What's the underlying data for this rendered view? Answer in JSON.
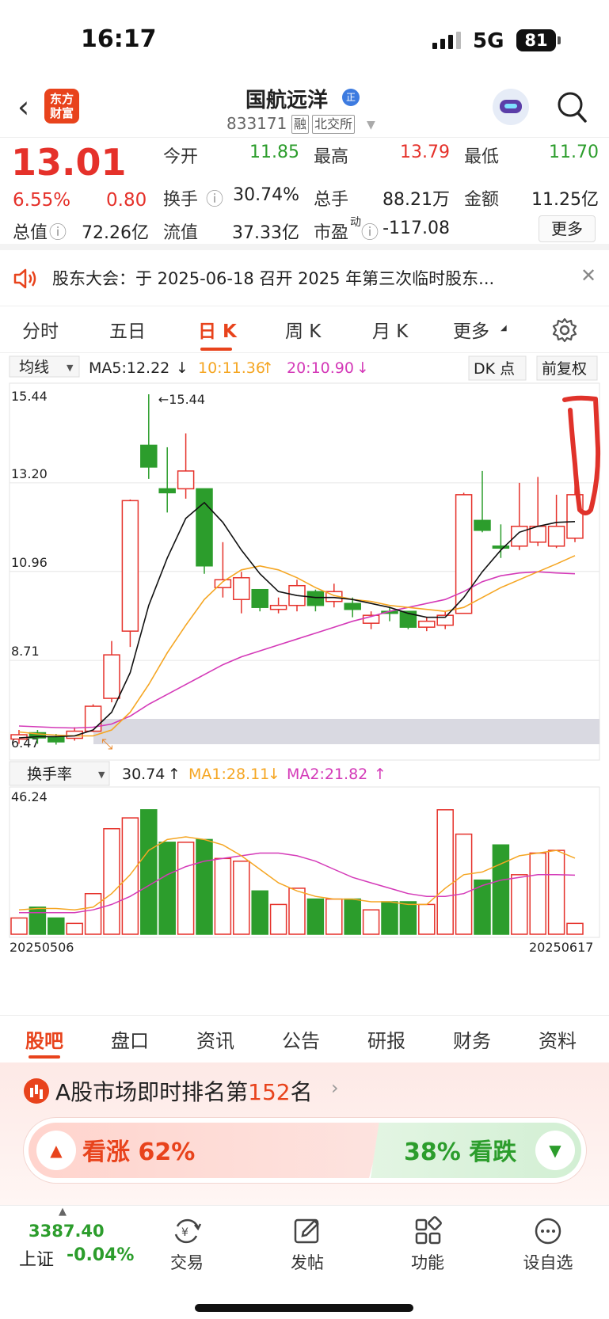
{
  "status": {
    "time": "16:17",
    "network": "5G",
    "battery": "81"
  },
  "nav": {
    "logo_text": "东方财富",
    "title": "国航远洋",
    "title_badge": "正",
    "code": "833171",
    "tags": [
      "融",
      "北交所"
    ]
  },
  "quote": {
    "price": "13.01",
    "change_pct": "6.55%",
    "change": "0.80",
    "fields": [
      {
        "label": "今开",
        "value": "11.85",
        "color": "green"
      },
      {
        "label": "最高",
        "value": "13.79",
        "color": "red"
      },
      {
        "label": "最低",
        "value": "11.70",
        "color": "green"
      },
      {
        "label": "换手",
        "value": "30.74%",
        "color": "black"
      },
      {
        "label": "总手",
        "value": "88.21万",
        "color": "black"
      },
      {
        "label": "金额",
        "value": "11.25亿",
        "color": "black"
      },
      {
        "label": "总值",
        "value": "72.26亿",
        "color": "black"
      },
      {
        "label": "流值",
        "value": "37.33亿",
        "color": "black"
      },
      {
        "label": "市盈",
        "value": "-117.08",
        "color": "black"
      }
    ],
    "pe_sup": "动",
    "more_label": "更多"
  },
  "notice": {
    "text": "股东大会：于 2025-06-18 召开 2025 年第三次临时股东..."
  },
  "chart_tabs": [
    "分时",
    "五日",
    "日 K",
    "周 K",
    "月 K",
    "更多"
  ],
  "chart_controls": {
    "indicator": "均线",
    "ma5": "MA5:12.22",
    "ma10": "10:11.36",
    "ma20": "20:10.90",
    "dk": "DK 点",
    "adjust": "前复权"
  },
  "chart_data": {
    "type": "candlestick",
    "y_ticks": [
      "15.44",
      "13.20",
      "10.96",
      "8.71",
      "6.47"
    ],
    "ylim": [
      6.47,
      15.44
    ],
    "max_label": "15.44",
    "min_label": "6.47",
    "candles": [
      {
        "o": 6.72,
        "c": 6.83,
        "h": 6.95,
        "l": 6.6,
        "up": true
      },
      {
        "o": 6.88,
        "c": 6.75,
        "h": 6.95,
        "l": 6.6,
        "up": false
      },
      {
        "o": 6.78,
        "c": 6.65,
        "h": 6.85,
        "l": 6.58,
        "up": false
      },
      {
        "o": 6.74,
        "c": 6.92,
        "h": 7.02,
        "l": 6.68,
        "up": true
      },
      {
        "o": 6.92,
        "c": 7.55,
        "h": 7.6,
        "l": 6.9,
        "up": true
      },
      {
        "o": 7.75,
        "c": 8.85,
        "h": 9.2,
        "l": 7.65,
        "up": true
      },
      {
        "o": 9.45,
        "c": 12.75,
        "h": 12.78,
        "l": 9.05,
        "up": true
      },
      {
        "o": 14.15,
        "c": 13.6,
        "h": 15.44,
        "l": 13.3,
        "up": false
      },
      {
        "o": 13.05,
        "c": 12.95,
        "h": 14.1,
        "l": 12.45,
        "up": false
      },
      {
        "o": 13.05,
        "c": 13.5,
        "h": 14.45,
        "l": 12.8,
        "up": true
      },
      {
        "o": 13.05,
        "c": 11.1,
        "h": 13.05,
        "l": 10.9,
        "up": false
      },
      {
        "o": 10.55,
        "c": 10.75,
        "h": 11.7,
        "l": 10.3,
        "up": true
      },
      {
        "o": 10.25,
        "c": 10.8,
        "h": 10.95,
        "l": 9.9,
        "up": true
      },
      {
        "o": 10.5,
        "c": 10.05,
        "h": 10.5,
        "l": 9.95,
        "up": false
      },
      {
        "o": 10.0,
        "c": 10.1,
        "h": 10.3,
        "l": 9.9,
        "up": true
      },
      {
        "o": 10.1,
        "c": 10.6,
        "h": 10.75,
        "l": 9.95,
        "up": true
      },
      {
        "o": 10.45,
        "c": 10.1,
        "h": 10.5,
        "l": 9.95,
        "up": false
      },
      {
        "o": 10.2,
        "c": 10.45,
        "h": 10.65,
        "l": 10.05,
        "up": true
      },
      {
        "o": 10.15,
        "c": 10.0,
        "h": 10.3,
        "l": 9.8,
        "up": false
      },
      {
        "o": 9.65,
        "c": 9.85,
        "h": 9.95,
        "l": 9.5,
        "up": true
      },
      {
        "o": 9.95,
        "c": 9.9,
        "h": 10.05,
        "l": 9.7,
        "up": false
      },
      {
        "o": 9.95,
        "c": 9.55,
        "h": 9.95,
        "l": 9.5,
        "up": false
      },
      {
        "o": 9.55,
        "c": 9.7,
        "h": 9.8,
        "l": 9.45,
        "up": true
      },
      {
        "o": 9.6,
        "c": 9.85,
        "h": 9.95,
        "l": 9.5,
        "up": true
      },
      {
        "o": 9.9,
        "c": 12.9,
        "h": 12.95,
        "l": 9.9,
        "up": true
      },
      {
        "o": 12.25,
        "c": 12.0,
        "h": 13.5,
        "l": 11.95,
        "up": false
      },
      {
        "o": 11.6,
        "c": 11.55,
        "h": 12.15,
        "l": 11.3,
        "up": false
      },
      {
        "o": 11.6,
        "c": 12.1,
        "h": 13.2,
        "l": 11.5,
        "up": true
      },
      {
        "o": 11.7,
        "c": 12.1,
        "h": 13.35,
        "l": 11.6,
        "up": true
      },
      {
        "o": 11.6,
        "c": 12.1,
        "h": 12.9,
        "l": 11.55,
        "up": true
      },
      {
        "o": 11.8,
        "c": 12.9,
        "h": 13.79,
        "l": 11.7,
        "up": true
      }
    ],
    "ma5": [
      6.75,
      6.78,
      6.78,
      6.8,
      6.95,
      7.4,
      8.4,
      10.1,
      11.3,
      12.3,
      12.7,
      12.2,
      11.5,
      10.9,
      10.45,
      10.35,
      10.3,
      10.3,
      10.25,
      10.15,
      10.05,
      9.9,
      9.8,
      9.8,
      10.3,
      10.95,
      11.5,
      11.95,
      12.1,
      12.2,
      12.22
    ],
    "ma10": [
      6.9,
      6.85,
      6.82,
      6.8,
      6.8,
      6.95,
      7.4,
      8.1,
      8.9,
      9.6,
      10.25,
      10.7,
      11.0,
      11.1,
      11.0,
      10.8,
      10.55,
      10.35,
      10.25,
      10.2,
      10.1,
      10.05,
      10.0,
      9.95,
      10.05,
      10.3,
      10.55,
      10.75,
      10.95,
      11.15,
      11.36
    ],
    "ma20": [
      7.05,
      7.03,
      7.01,
      7.0,
      7.02,
      7.1,
      7.3,
      7.6,
      7.85,
      8.1,
      8.35,
      8.6,
      8.8,
      8.95,
      9.1,
      9.25,
      9.4,
      9.55,
      9.7,
      9.82,
      9.95,
      10.05,
      10.15,
      10.25,
      10.45,
      10.7,
      10.85,
      10.92,
      10.95,
      10.92,
      10.9
    ]
  },
  "volume_controls": {
    "indicator": "换手率",
    "value": "30.74",
    "ma1": "MA1:28.11",
    "ma2": "MA2:21.82"
  },
  "volume_data": {
    "max_label": "46.24",
    "values": [
      6,
      10,
      6,
      4,
      15,
      39,
      43,
      46,
      34,
      34,
      35,
      28,
      27,
      16,
      11,
      17,
      13,
      13,
      13,
      9,
      12,
      12,
      11,
      46,
      37,
      20,
      33,
      22,
      30,
      31,
      4
    ],
    "ma1": [
      9,
      9.5,
      9.5,
      9,
      10,
      15,
      22,
      31,
      35,
      36,
      35,
      33,
      29,
      24,
      19,
      16,
      14,
      13,
      13,
      12,
      12,
      11,
      11,
      17,
      22,
      23,
      26,
      29,
      30,
      31,
      28.11
    ],
    "ma2": [
      8,
      8,
      8,
      8,
      9,
      11,
      14,
      18,
      22,
      25,
      27,
      28,
      29,
      30,
      30,
      29,
      27,
      24,
      21,
      19,
      17,
      15,
      14,
      14,
      15,
      18,
      20,
      21,
      22,
      22,
      21.82
    ],
    "date_start": "20250506",
    "date_end": "20250617"
  },
  "bottom_tabs": [
    "股吧",
    "盘口",
    "资讯",
    "公告",
    "研报",
    "财务",
    "资料"
  ],
  "rank": {
    "prefix": "A股市场即时排名第",
    "number": "152",
    "suffix": "名"
  },
  "vote": {
    "up": "看涨 62%",
    "down": "38% 看跌"
  },
  "index": {
    "value": "3387.40",
    "name": "上证",
    "change": "-0.04%"
  },
  "bottom_nav": [
    "交易",
    "发帖",
    "功能",
    "设自选"
  ],
  "colors": {
    "up": "#e5312a",
    "down": "#2c9d2c",
    "ma5": "#111111",
    "ma10": "#f5a623",
    "ma20": "#d43ab8",
    "accent": "#e8431c"
  }
}
